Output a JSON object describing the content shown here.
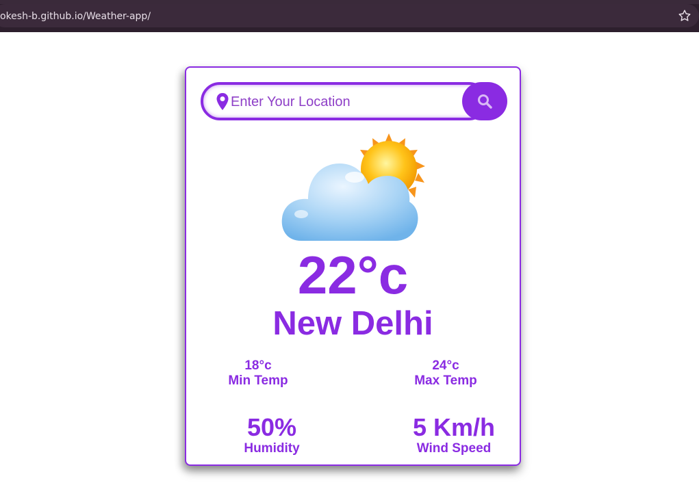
{
  "browser": {
    "url": "okesh-b.github.io/Weather-app/"
  },
  "search": {
    "placeholder": "Enter Your Location",
    "value": ""
  },
  "weather": {
    "condition_icon": "partly-cloudy-icon",
    "temperature": "22°c",
    "city": "New Delhi",
    "min_temp": "18°c",
    "min_temp_label": "Min Temp",
    "max_temp": "24°c",
    "max_temp_label": "Max Temp",
    "humidity": "50%",
    "humidity_label": "Humidity",
    "wind_speed": "5 Km/h",
    "wind_speed_label": "Wind Speed"
  },
  "colors": {
    "accent": "#8a2be2",
    "browser_bg": "#2d1f2d"
  }
}
